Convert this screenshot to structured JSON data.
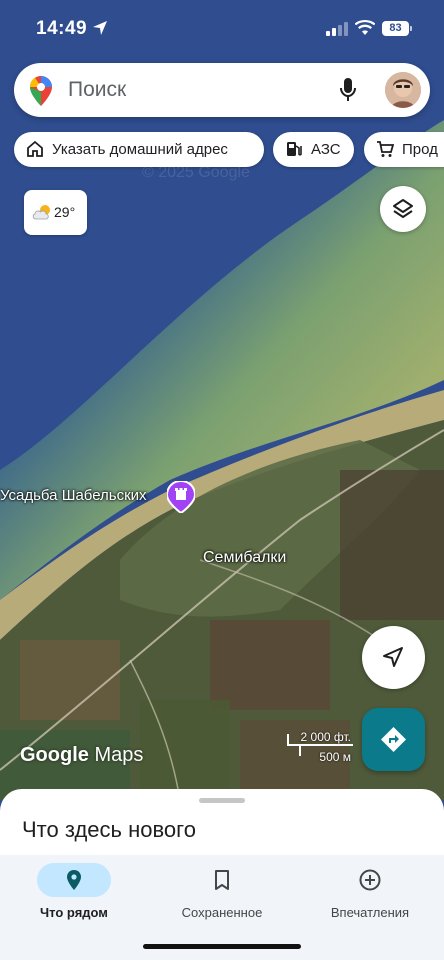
{
  "status_bar": {
    "time": "14:49",
    "battery": "83"
  },
  "search": {
    "placeholder": "Поиск"
  },
  "chips": {
    "home": "Указать домашний адрес",
    "gas": "АЗС",
    "shop": "Прод"
  },
  "map": {
    "watermark": "© 2025 Google",
    "weather_temp": "29°",
    "place_usadba": "Усадьба Шабельских",
    "place_semibalki": "Семибалки",
    "logo_google": "Google",
    "logo_maps": "Maps",
    "scale_ft": "2 000 фт.",
    "scale_m": "500 м"
  },
  "sheet": {
    "title": "Что здесь нового"
  },
  "nav": {
    "nearby": "Что рядом",
    "saved": "Сохраненное",
    "impressions": "Впечатления"
  },
  "colors": {
    "sea": "#2f4d8f",
    "accent_teal": "#0b7a8a",
    "nav_active": "#c2e7ff"
  }
}
